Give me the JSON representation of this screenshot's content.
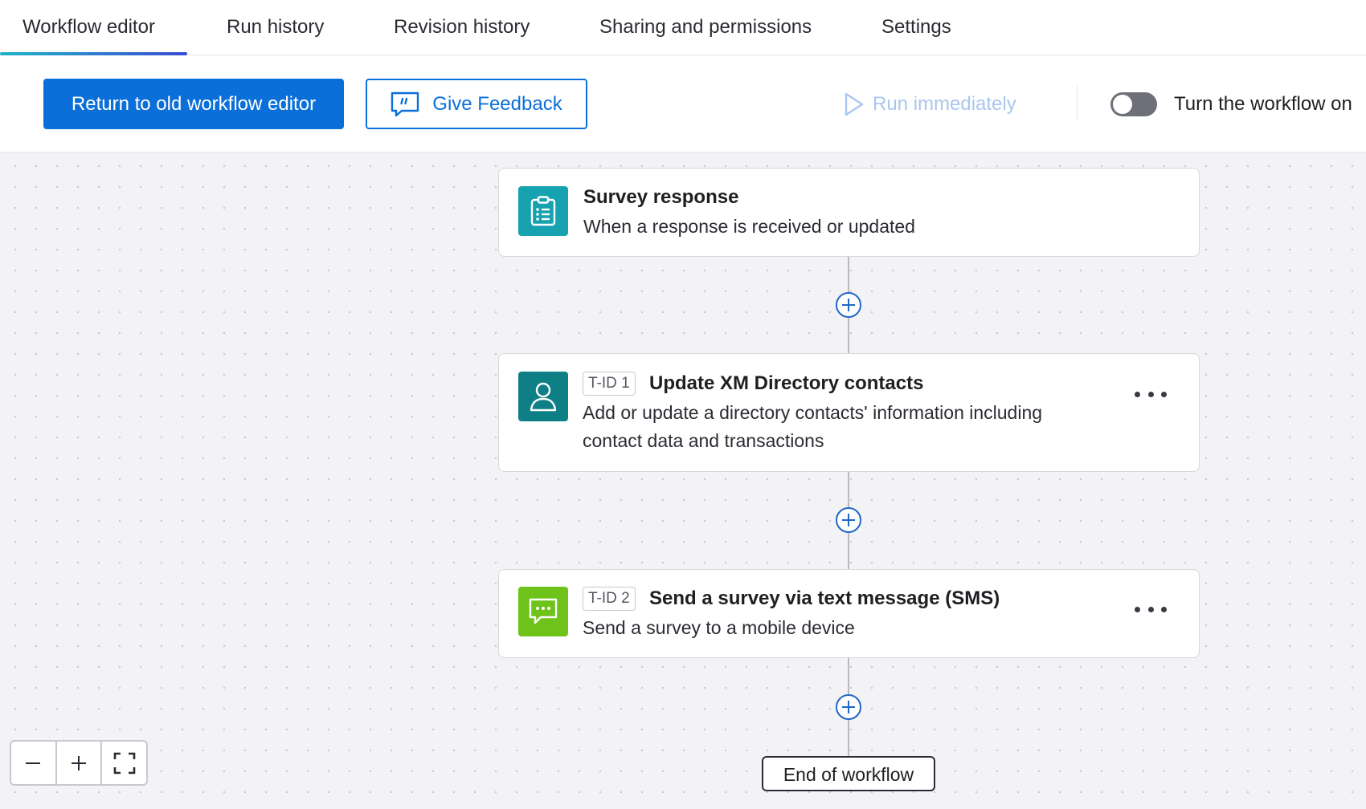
{
  "tabs": [
    {
      "label": "Workflow editor",
      "active": true
    },
    {
      "label": "Run history"
    },
    {
      "label": "Revision history"
    },
    {
      "label": "Sharing and permissions"
    },
    {
      "label": "Settings"
    }
  ],
  "toolbar": {
    "return_label": "Return to old workflow editor",
    "feedback_label": "Give Feedback",
    "run_label": "Run immediately",
    "toggle_label": "Turn the workflow on",
    "toggle_on": false
  },
  "workflow": {
    "trigger": {
      "title": "Survey response",
      "desc": "When a response is received or updated",
      "icon": "clipboard-icon",
      "color": "#17a2b0"
    },
    "tasks": [
      {
        "tid": "T-ID 1",
        "title": "Update XM Directory contacts",
        "desc": "Add or update a directory contacts' information including contact data and transactions",
        "icon": "person-icon",
        "color": "#0f7f86"
      },
      {
        "tid": "T-ID 2",
        "title": "Send a survey via text message (SMS)",
        "desc": "Send a survey to a mobile device",
        "icon": "chat-bubble-icon",
        "color": "#6ec21a"
      }
    ],
    "end_label": "End of workflow"
  },
  "colors": {
    "accent": "#0b6fd9",
    "plus": "#1f66c9"
  }
}
